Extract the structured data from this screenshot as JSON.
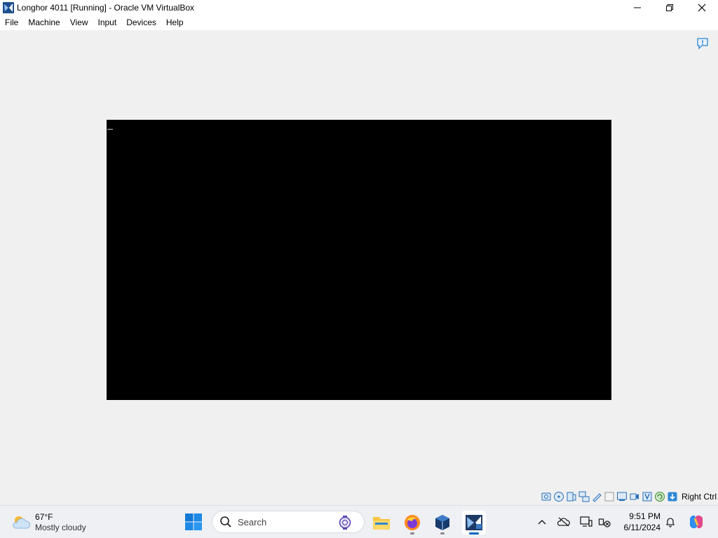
{
  "window": {
    "title": "Longhor 4011 [Running] - Oracle VM VirtualBox",
    "icon": "virtualbox-icon",
    "controls": [
      "minimize-icon",
      "maximize-icon",
      "close-icon"
    ]
  },
  "menu": {
    "items": [
      "File",
      "Machine",
      "View",
      "Input",
      "Devices",
      "Help"
    ]
  },
  "vm": {
    "screen_color": "#000000"
  },
  "statusbar": {
    "icons": [
      "hard-disk-icon",
      "optical-drive-icon",
      "audio-icon",
      "network-icon",
      "usb-icon",
      "shared-folders-icon",
      "display-icon",
      "recording-icon",
      "mouse-integration-icon",
      "cpu-icon",
      "hostkey-icon"
    ],
    "host_key": "Right Ctrl"
  },
  "taskbar": {
    "weather": {
      "temp": "67°F",
      "condition": "Mostly cloudy",
      "icon": "cloud-sun-icon"
    },
    "search": {
      "placeholder": "Search"
    },
    "apps": [
      "file-explorer-icon",
      "firefox-icon",
      "virtualbox-icon",
      "longhorn-vm-icon"
    ],
    "tray": [
      "chevron-up-icon",
      "cloud-offline-icon",
      "display-project-icon",
      "network-disconnected-icon"
    ],
    "clock": {
      "time": "9:51 PM",
      "date": "6/11/2024"
    },
    "accent": "#0067c0"
  }
}
